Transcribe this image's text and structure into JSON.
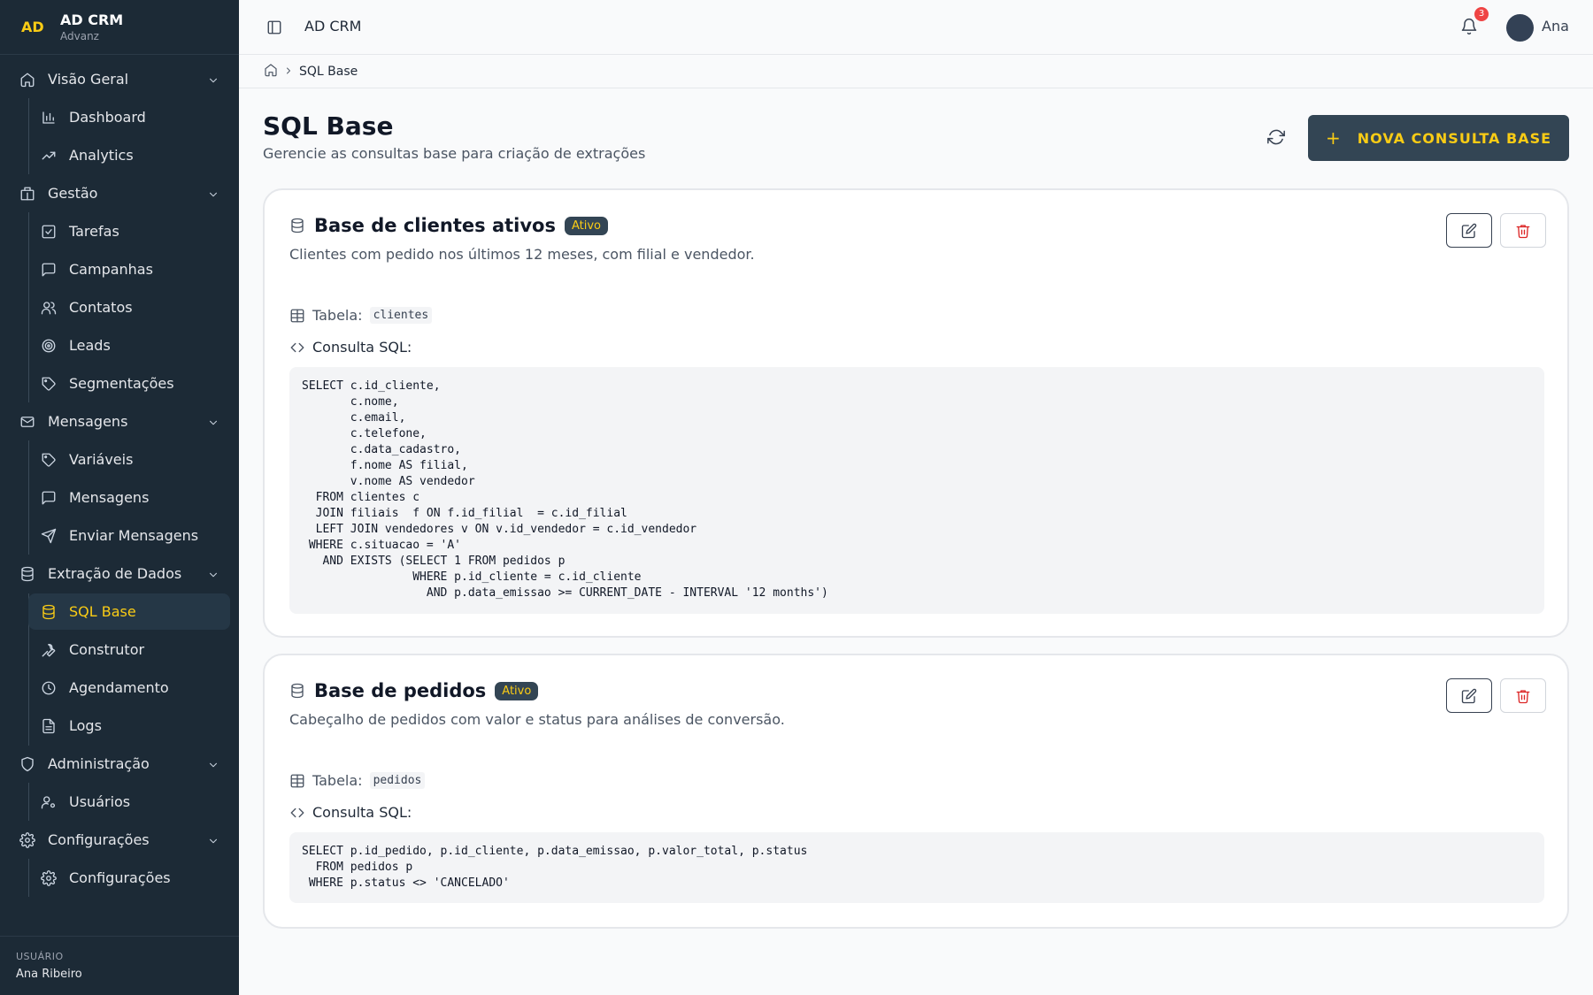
{
  "brand": {
    "logo": "AD",
    "name": "AD CRM",
    "subtitle": "Advanz"
  },
  "sidebar": {
    "groups": [
      {
        "label": "Visão Geral",
        "icon": "home-icon",
        "items": [
          {
            "label": "Dashboard",
            "icon": "bar-chart-icon"
          },
          {
            "label": "Analytics",
            "icon": "trending-up-icon"
          }
        ]
      },
      {
        "label": "Gestão",
        "icon": "building-icon",
        "items": [
          {
            "label": "Tarefas",
            "icon": "check-square-icon"
          },
          {
            "label": "Campanhas",
            "icon": "message-square-icon"
          },
          {
            "label": "Contatos",
            "icon": "users-icon"
          },
          {
            "label": "Leads",
            "icon": "target-icon"
          },
          {
            "label": "Segmentações",
            "icon": "tag-icon"
          }
        ]
      },
      {
        "label": "Mensagens",
        "icon": "mail-icon",
        "items": [
          {
            "label": "Variáveis",
            "icon": "tag-icon"
          },
          {
            "label": "Mensagens",
            "icon": "message-square-icon"
          },
          {
            "label": "Enviar Mensagens",
            "icon": "send-icon"
          }
        ]
      },
      {
        "label": "Extração de Dados",
        "icon": "database-icon",
        "items": [
          {
            "label": "SQL Base",
            "icon": "database-icon",
            "active": true
          },
          {
            "label": "Construtor",
            "icon": "wrench-icon"
          },
          {
            "label": "Agendamento",
            "icon": "clock-icon"
          },
          {
            "label": "Logs",
            "icon": "file-text-icon"
          }
        ]
      },
      {
        "label": "Administração",
        "icon": "shield-icon",
        "items": [
          {
            "label": "Usuários",
            "icon": "user-cog-icon"
          }
        ]
      },
      {
        "label": "Configurações",
        "icon": "gear-icon",
        "items": [
          {
            "label": "Configurações",
            "icon": "gear-icon"
          }
        ]
      }
    ],
    "footer": {
      "caption": "USUÁRIO",
      "name": "Ana Ribeiro"
    }
  },
  "topbar": {
    "title": "AD CRM",
    "notification_count": "3",
    "user_name": "Ana"
  },
  "breadcrumb": {
    "current": "SQL Base"
  },
  "header": {
    "title": "SQL Base",
    "subtitle": "Gerencie as consultas base para criação de extrações",
    "new_button": "NOVA CONSULTA BASE"
  },
  "colors": {
    "sidebar_bg": "#1c2a36",
    "accent": "#facc15",
    "button_bg": "#334554",
    "danger": "#dc2626"
  },
  "queries": [
    {
      "title": "Base de clientes ativos",
      "status": "Ativo",
      "description": "Clientes com pedido nos últimos 12 meses, com filial e vendedor.",
      "table_label": "Tabela:",
      "table": "clientes",
      "sql_label": "Consulta SQL:",
      "sql": "SELECT c.id_cliente,\n       c.nome,\n       c.email,\n       c.telefone,\n       c.data_cadastro,\n       f.nome AS filial,\n       v.nome AS vendedor\n  FROM clientes c\n  JOIN filiais  f ON f.id_filial  = c.id_filial\n  LEFT JOIN vendedores v ON v.id_vendedor = c.id_vendedor\n WHERE c.situacao = 'A'\n   AND EXISTS (SELECT 1 FROM pedidos p\n                WHERE p.id_cliente = c.id_cliente\n                  AND p.data_emissao >= CURRENT_DATE - INTERVAL '12 months')"
    },
    {
      "title": "Base de pedidos",
      "status": "Ativo",
      "description": "Cabeçalho de pedidos com valor e status para análises de conversão.",
      "table_label": "Tabela:",
      "table": "pedidos",
      "sql_label": "Consulta SQL:",
      "sql": "SELECT p.id_pedido, p.id_cliente, p.data_emissao, p.valor_total, p.status\n  FROM pedidos p\n WHERE p.status <> 'CANCELADO'"
    }
  ]
}
